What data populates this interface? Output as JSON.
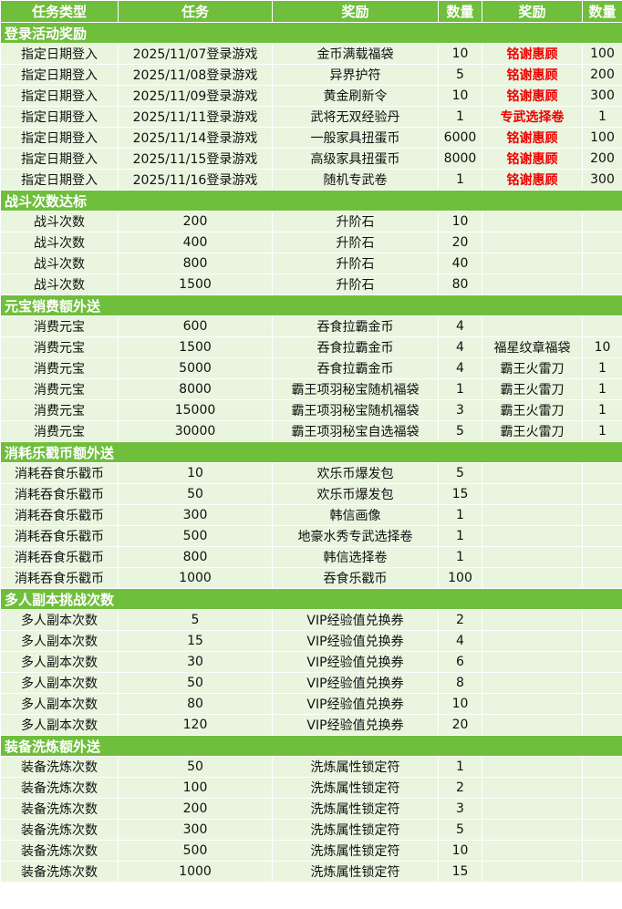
{
  "headers": [
    "任务类型",
    "任务",
    "奖励",
    "数量",
    "奖励",
    "数量"
  ],
  "sections": [
    {
      "title": "登录活动奖励",
      "rows": [
        {
          "type": "指定日期登入",
          "task": "2025/11/07登录游戏",
          "reward": "金币满载福袋",
          "qty": "10",
          "reward2": "铭谢惠顾",
          "qty2": "100"
        },
        {
          "type": "指定日期登入",
          "task": "2025/11/08登录游戏",
          "reward": "异界护符",
          "qty": "5",
          "reward2": "铭谢惠顾",
          "qty2": "200"
        },
        {
          "type": "指定日期登入",
          "task": "2025/11/09登录游戏",
          "reward": "黄金刷新令",
          "qty": "10",
          "reward2": "铭谢惠顾",
          "qty2": "300"
        },
        {
          "type": "指定日期登入",
          "task": "2025/11/11登录游戏",
          "reward": "武将无双经验丹",
          "qty": "1",
          "reward2": "专武选择卷",
          "qty2": "1"
        },
        {
          "type": "指定日期登入",
          "task": "2025/11/14登录游戏",
          "reward": "一般家具扭蛋币",
          "qty": "6000",
          "reward2": "铭谢惠顾",
          "qty2": "100"
        },
        {
          "type": "指定日期登入",
          "task": "2025/11/15登录游戏",
          "reward": "高级家具扭蛋币",
          "qty": "8000",
          "reward2": "铭谢惠顾",
          "qty2": "200"
        },
        {
          "type": "指定日期登入",
          "task": "2025/11/16登录游戏",
          "reward": "随机专武卷",
          "qty": "1",
          "reward2": "铭谢惠顾",
          "qty2": "300"
        }
      ]
    },
    {
      "title": "战斗次数达标",
      "rows": [
        {
          "type": "战斗次数",
          "task": "200",
          "reward": "升阶石",
          "qty": "10",
          "reward2": "",
          "qty2": ""
        },
        {
          "type": "战斗次数",
          "task": "400",
          "reward": "升阶石",
          "qty": "20",
          "reward2": "",
          "qty2": ""
        },
        {
          "type": "战斗次数",
          "task": "800",
          "reward": "升阶石",
          "qty": "40",
          "reward2": "",
          "qty2": ""
        },
        {
          "type": "战斗次数",
          "task": "1500",
          "reward": "升阶石",
          "qty": "80",
          "reward2": "",
          "qty2": ""
        }
      ]
    },
    {
      "title": "元宝销费额外送",
      "rows": [
        {
          "type": "消费元宝",
          "task": "600",
          "reward": "吞食拉霸金币",
          "qty": "4",
          "reward2": "",
          "qty2": ""
        },
        {
          "type": "消费元宝",
          "task": "1500",
          "reward": "吞食拉霸金币",
          "qty": "4",
          "reward2": "福星纹章福袋",
          "qty2": "10"
        },
        {
          "type": "消费元宝",
          "task": "5000",
          "reward": "吞食拉霸金币",
          "qty": "4",
          "reward2": "霸王火雷刀",
          "qty2": "1"
        },
        {
          "type": "消费元宝",
          "task": "8000",
          "reward": "霸王项羽秘宝随机福袋",
          "qty": "1",
          "reward2": "霸王火雷刀",
          "qty2": "1"
        },
        {
          "type": "消费元宝",
          "task": "15000",
          "reward": "霸王项羽秘宝随机福袋",
          "qty": "3",
          "reward2": "霸王火雷刀",
          "qty2": "1"
        },
        {
          "type": "消费元宝",
          "task": "30000",
          "reward": "霸王项羽秘宝自选福袋",
          "qty": "5",
          "reward2": "霸王火雷刀",
          "qty2": "1"
        }
      ]
    },
    {
      "title": "消耗乐戳币额外送",
      "rows": [
        {
          "type": "消耗吞食乐戳币",
          "task": "10",
          "reward": "欢乐币爆发包",
          "qty": "5",
          "reward2": "",
          "qty2": ""
        },
        {
          "type": "消耗吞食乐戳币",
          "task": "50",
          "reward": "欢乐币爆发包",
          "qty": "15",
          "reward2": "",
          "qty2": ""
        },
        {
          "type": "消耗吞食乐戳币",
          "task": "300",
          "reward": "韩信画像",
          "qty": "1",
          "reward2": "",
          "qty2": ""
        },
        {
          "type": "消耗吞食乐戳币",
          "task": "500",
          "reward": "地豪水秀专武选择卷",
          "qty": "1",
          "reward2": "",
          "qty2": ""
        },
        {
          "type": "消耗吞食乐戳币",
          "task": "800",
          "reward": "韩信选择卷",
          "qty": "1",
          "reward2": "",
          "qty2": ""
        },
        {
          "type": "消耗吞食乐戳币",
          "task": "1000",
          "reward": "吞食乐戳币",
          "qty": "100",
          "reward2": "",
          "qty2": ""
        }
      ]
    },
    {
      "title": "多人副本挑战次数",
      "rows": [
        {
          "type": "多人副本次数",
          "task": "5",
          "reward": "VIP经验值兑换券",
          "qty": "2",
          "reward2": "",
          "qty2": ""
        },
        {
          "type": "多人副本次数",
          "task": "15",
          "reward": "VIP经验值兑换券",
          "qty": "4",
          "reward2": "",
          "qty2": ""
        },
        {
          "type": "多人副本次数",
          "task": "30",
          "reward": "VIP经验值兑换券",
          "qty": "6",
          "reward2": "",
          "qty2": ""
        },
        {
          "type": "多人副本次数",
          "task": "50",
          "reward": "VIP经验值兑换券",
          "qty": "8",
          "reward2": "",
          "qty2": ""
        },
        {
          "type": "多人副本次数",
          "task": "80",
          "reward": "VIP经验值兑换券",
          "qty": "10",
          "reward2": "",
          "qty2": ""
        },
        {
          "type": "多人副本次数",
          "task": "120",
          "reward": "VIP经验值兑换券",
          "qty": "20",
          "reward2": "",
          "qty2": ""
        }
      ]
    },
    {
      "title": "装备洗炼额外送",
      "rows": [
        {
          "type": "装备洗炼次数",
          "task": "50",
          "reward": "洗炼属性锁定符",
          "qty": "1",
          "reward2": "",
          "qty2": ""
        },
        {
          "type": "装备洗炼次数",
          "task": "100",
          "reward": "洗炼属性锁定符",
          "qty": "2",
          "reward2": "",
          "qty2": ""
        },
        {
          "type": "装备洗炼次数",
          "task": "200",
          "reward": "洗炼属性锁定符",
          "qty": "3",
          "reward2": "",
          "qty2": ""
        },
        {
          "type": "装备洗炼次数",
          "task": "300",
          "reward": "洗炼属性锁定符",
          "qty": "5",
          "reward2": "",
          "qty2": ""
        },
        {
          "type": "装备洗炼次数",
          "task": "500",
          "reward": "洗炼属性锁定符",
          "qty": "10",
          "reward2": "",
          "qty2": ""
        },
        {
          "type": "装备洗炼次数",
          "task": "1000",
          "reward": "洗炼属性锁定符",
          "qty": "15",
          "reward2": "",
          "qty2": ""
        }
      ]
    }
  ],
  "highlight_color": "#ee0000",
  "header_color": "#6fbe3c",
  "row_color": "#e9f5df"
}
